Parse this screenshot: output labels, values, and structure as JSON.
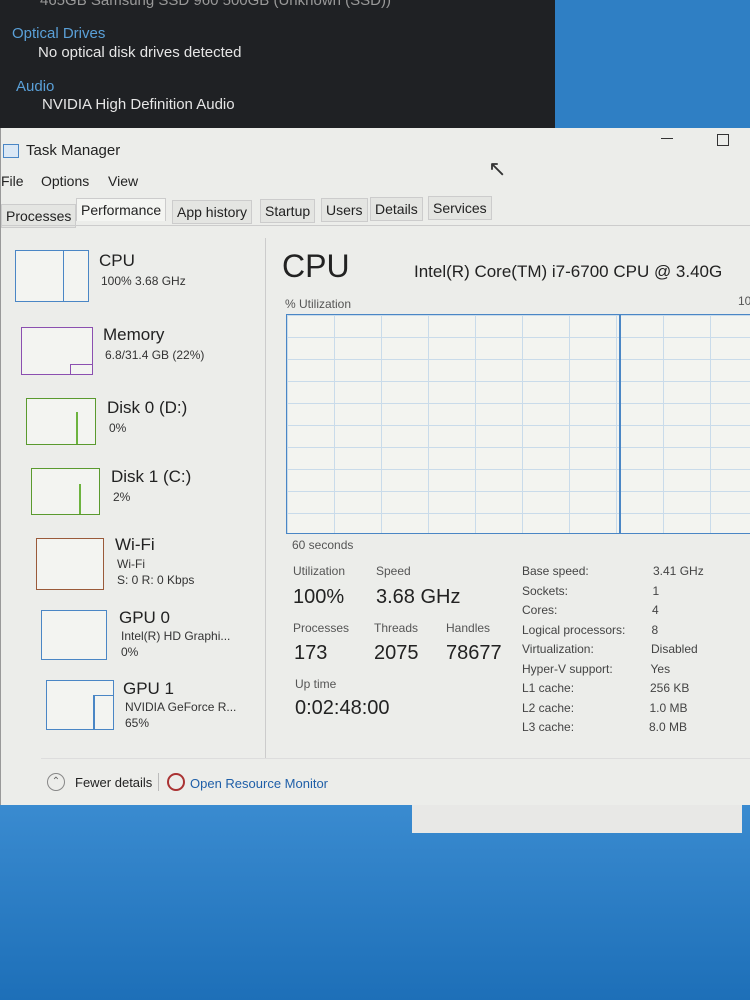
{
  "background_window": {
    "partial_line": "465GB Samsung SSD 960 500GB (Unknown (SSD))",
    "sections": [
      {
        "heading": "Optical Drives",
        "value": "No optical disk drives detected"
      },
      {
        "heading": "Audio",
        "value": "NVIDIA High Definition Audio"
      }
    ]
  },
  "window": {
    "title": "Task Manager",
    "menu": [
      "File",
      "Options",
      "View"
    ],
    "tabs": [
      "Processes",
      "Performance",
      "App history",
      "Startup",
      "Users",
      "Details",
      "Services"
    ],
    "active_tab": "Performance"
  },
  "sidebar": [
    {
      "title": "CPU",
      "sub1": "100% 3.68 GHz",
      "color": "#4a86c5"
    },
    {
      "title": "Memory",
      "sub1": "6.8/31.4 GB (22%)",
      "color": "#8b4fb0"
    },
    {
      "title": "Disk 0 (D:)",
      "sub1": "0%",
      "color": "#5a9a2e"
    },
    {
      "title": "Disk 1 (C:)",
      "sub1": "2%",
      "color": "#5a9a2e"
    },
    {
      "title": "Wi-Fi",
      "sub1": "Wi-Fi",
      "sub2": "S: 0 R: 0 Kbps",
      "color": "#9a5a3a"
    },
    {
      "title": "GPU 0",
      "sub1": "Intel(R) HD Graphi...",
      "sub2": "0%",
      "color": "#4a86c5"
    },
    {
      "title": "GPU 1",
      "sub1": "NVIDIA GeForce R...",
      "sub2": "65%",
      "color": "#4a86c5"
    }
  ],
  "main": {
    "title": "CPU",
    "cpu_name": "Intel(R) Core(TM) i7-6700 CPU @ 3.40G",
    "graph_label": "% Utilization",
    "graph_max": "10",
    "time_label": "60 seconds",
    "stats": {
      "utilization_label": "Utilization",
      "utilization": "100%",
      "speed_label": "Speed",
      "speed": "3.68 GHz",
      "processes_label": "Processes",
      "processes": "173",
      "threads_label": "Threads",
      "threads": "2075",
      "handles_label": "Handles",
      "handles": "78677",
      "uptime_label": "Up time",
      "uptime": "0:02:48:00"
    },
    "specs": [
      [
        "Base speed:",
        "3.41 GHz"
      ],
      [
        "Sockets:",
        "1"
      ],
      [
        "Cores:",
        "4"
      ],
      [
        "Logical processors:",
        "8"
      ],
      [
        "Virtualization:",
        "Disabled"
      ],
      [
        "Hyper-V support:",
        "Yes"
      ],
      [
        "L1 cache:",
        "256 KB"
      ],
      [
        "L2 cache:",
        "1.0 MB"
      ],
      [
        "L3 cache:",
        "8.0 MB"
      ]
    ]
  },
  "footer": {
    "fewer_details": "Fewer details",
    "open_resource_monitor": "Open Resource Monitor"
  }
}
